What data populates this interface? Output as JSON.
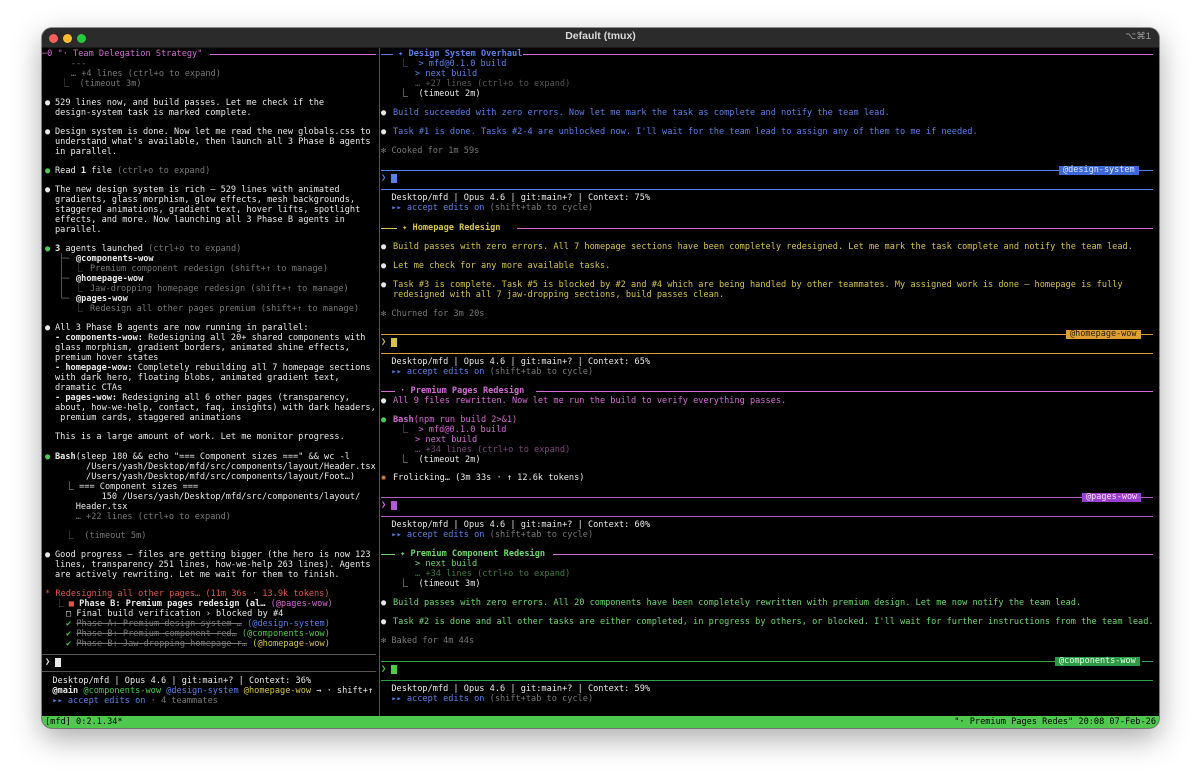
{
  "window": {
    "title": "Default (tmux)",
    "shortcut": "⌥⌘1"
  },
  "left": {
    "header": "─0 \"· Team Delegation Strategy\"",
    "l1": "     ---",
    "l2": "     … +4 lines (ctrl+o to expand)",
    "l3": "   ⎿  (timeout 3m)",
    "m1a": "529 lines now, and build passes. Let me check if the",
    "m1b": "design-system task is marked complete.",
    "m2a": "Design system is done. Now let me read the new globals.css to",
    "m2b": "understand what's available, then launch all 3 Phase B agents",
    "m2c": "in parallel.",
    "read_pre": "Read ",
    "read_num": "1",
    "read_file": " file",
    "read_hint": " (ctrl+o to expand)",
    "m4a": "The new design system is rich — 529 lines with animated",
    "m4b": "gradients, glass morphism, glow effects, mesh backgrounds,",
    "m4c": "staggered animations, gradient text, hover lifts, spotlight",
    "m4d": "effects, and more. Now launching all 3 Phase B agents in",
    "m4e": "parallel.",
    "agents_num": "3",
    "agents_text": " agents launched",
    "agents_hint": " (ctrl+o to expand)",
    "a1": "@components-wow",
    "a1d": "Premium component redesign (shift+↑ to manage)",
    "a2": "@homepage-wow",
    "a2d": "Jaw-dropping homepage redesign (shift+↑ to manage)",
    "a3": "@pages-wow",
    "a3d": "Redesign all other pages premium (shift+↑ to manage)",
    "r1": "All 3 Phase B agents are now running in parallel:",
    "r2k": "- components-wow:",
    "r2v": " Redesigning all 20+ shared components with",
    "r3": "glass morphism, gradient borders, animated shine effects,",
    "r4": "premium hover states",
    "r5k": "- homepage-wow:",
    "r5v": " Completely rebuilding all 7 homepage sections",
    "r6": "with dark hero, floating blobs, animated gradient text,",
    "r7": "dramatic CTAs",
    "r8k": "- pages-wow:",
    "r8v": " Redesigning all 6 other pages (transparency,",
    "r9": "about, how-we-help, contact, faq, insights) with dark headers,",
    "r10": " premium cards, staggered animations",
    "r11": "This is a large amount of work. Let me monitor progress.",
    "bash_k": "Bash",
    "bash1": "(sleep 180 && echo \"=== Component sizes ===\" && wc -l",
    "bash2": "      /Users/yash/Desktop/mfd/src/components/layout/Header.tsx",
    "bash3": "      /Users/yash/Desktop/mfd/src/components/layout/Foot…)",
    "bash4": "  ⎿ === Component sizes ===",
    "bash5": "         150 /Users/yash/Desktop/mfd/src/components/layout/",
    "bash6": "    Header.tsx",
    "bash7": "    … +22 lines (ctrl+o to expand)",
    "bash8": "  ⎿  (timeout 5m)",
    "gp1": "Good progress — files are getting bigger (the hero is now 123",
    "gp2": "lines, transparency 251 lines, how-we-help 263 lines). Agents",
    "gp3": "are actively rewriting. Let me wait for them to finish.",
    "spin": "* Redesigning all other pages… (11m 36s · 13.9k tokens)",
    "t1": "Phase B: Premium pages redesign (al…",
    "t1o": " (@pages-wow)",
    "t2": "Final build verification › blocked by #4",
    "t3": "Phase A: Premium design system …",
    "t3o": " (@design-system)",
    "t4": "Phase B: Premium component red…",
    "t4o": " (@components-wow)",
    "t5": "Phase B: Jaw-dropping homepage r…",
    "t5o": " (@homepage-wow)",
    "prompt": "❯ ",
    "st1": "  Desktop/mfd | Opus 4.6 | git:main+? | Context: 36%",
    "st2_main": "  @main",
    "st2_c": " @components-wow",
    "st2_d": " @design-system",
    "st2_h": " @homepage-wow",
    "st2_rest": " → · shift+↑",
    "st3a": "  ▸▸ accept edits on",
    "st3b": " · 4 teammates"
  },
  "p1": {
    "header": " ✦ Design System Overhaul ",
    "l1": "   ⎿  > mfd@0.1.0 build",
    "l2": "      > next build",
    "l3": "      … +27 lines (ctrl+o to expand)",
    "l4": "   ⎿  (timeout 2m)",
    "m1": "Build succeeded with zero errors. Now let me mark the task as complete and notify the team lead.",
    "m2": "Task #1 is done. Tasks #2-4 are unblocked now. I'll wait for the team lead to assign any of them to me if needed.",
    "cooked": "✻ Cooked for 1m 59s",
    "badge": "@design-system",
    "st1": "  Desktop/mfd | Opus 4.6 | git:main+? | Context: 75%",
    "st2a": "  ▸▸ accept edits on",
    "st2b": " (shift+tab to cycle)"
  },
  "p2": {
    "header": " ✦ Homepage Redesign ",
    "m1": "Build passes with zero errors. All 7 homepage sections have been completely redesigned. Let me mark the task complete and notify the team lead.",
    "m2": "Let me check for any more available tasks.",
    "m3a": "Task #3 is complete. Task #5 is blocked by #2 and #4 which are being handled by other teammates. My assigned work is done — homepage is fully",
    "m3b": "redesigned with all 7 jaw-dropping sections, build passes clean.",
    "churn": "✻ Churned for 3m 20s",
    "badge": "@homepage-wow",
    "st1": "  Desktop/mfd | Opus 4.6 | git:main+? | Context: 65%",
    "st2a": "  ▸▸ accept edits on",
    "st2b": " (shift+tab to cycle)"
  },
  "p3": {
    "header": " · Premium Pages Redesign ",
    "m1": "All 9 files rewritten. Now let me run the build to verify everything passes.",
    "bash_k": "Bash",
    "bash_v": "(npm run build 2>&1)",
    "l1": "   ⎿  > mfd@0.1.0 build",
    "l2": "      > next build",
    "l3": "      … +34 lines (ctrl+o to expand)",
    "l4": "   ⎿  (timeout 2m)",
    "frol": "Frolicking… (3m 33s · ↑ 12.6k tokens)",
    "badge": "@pages-wow",
    "st1": "  Desktop/mfd | Opus 4.6 | git:main+? | Context: 60%",
    "st2a": "  ▸▸ accept edits on",
    "st2b": " (shift+tab to cycle)"
  },
  "p4": {
    "header": " ✦ Premium Component Redesign ",
    "l1": "      > next build",
    "l2": "      … +34 lines (ctrl+o to expand)",
    "l3": "   ⎿  (timeout 3m)",
    "m1": "Build passes with zero errors. All 20 components have been completely rewritten with premium design. Let me now notify the team lead.",
    "m2": "Task #2 is done and all other tasks are either completed, in progress by others, or blocked. I'll wait for further instructions from the team lead.",
    "baked": "✻ Baked for 4m 44s",
    "badge": "@components-wow",
    "st1": "  Desktop/mfd | Opus 4.6 | git:main+? | Context: 59%",
    "st2a": "  ▸▸ accept edits on",
    "st2b": " (shift+tab to cycle)"
  },
  "statusbar": {
    "left": "[mfd] 0:2.1.34*",
    "right": "\"· Premium Pages Redes\" 20:08 07-Feb-26"
  },
  "colors": {
    "blue": "#5b7fe8",
    "yellow": "#d6c34a",
    "orange": "#e08a3c",
    "pink": "#d36bd3",
    "green": "#4ec94e"
  }
}
